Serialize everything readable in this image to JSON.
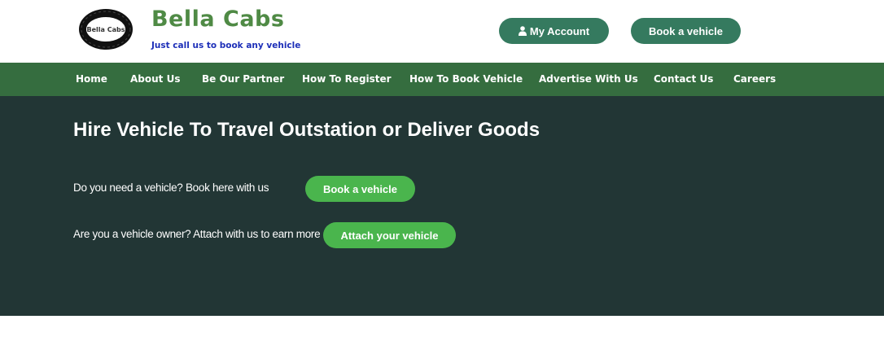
{
  "header": {
    "brand_name": "Bella Cabs",
    "tagline": "Just call us to book any vehicle",
    "logo_text": "Bella Cabs",
    "account_button": "My Account",
    "book_button": "Book a vehicle",
    "accent_color": "#357a5f",
    "brand_color": "#4f8a45",
    "tagline_color": "#1d2fb8"
  },
  "nav": {
    "background_color": "#356d3f",
    "items": [
      {
        "label": "Home"
      },
      {
        "label": "About Us"
      },
      {
        "label": "Be Our Partner"
      },
      {
        "label": "How To Register"
      },
      {
        "label": "How To Book Vehicle"
      },
      {
        "label": "Advertise With Us"
      },
      {
        "label": "Contact Us"
      },
      {
        "label": "Careers"
      }
    ]
  },
  "hero": {
    "background_color": "#223635",
    "title": "Hire Vehicle To Travel Outstation or Deliver Goods",
    "book_text": "Do you need a vehicle? Book here with us",
    "book_button": "Book a vehicle",
    "attach_text": "Are you a vehicle owner? Attach with us to earn more",
    "attach_button": "Attach your vehicle",
    "button_color": "#4ab54d"
  },
  "icons": {
    "account_icon": "user-icon",
    "logo_icon": "tire-logo"
  }
}
